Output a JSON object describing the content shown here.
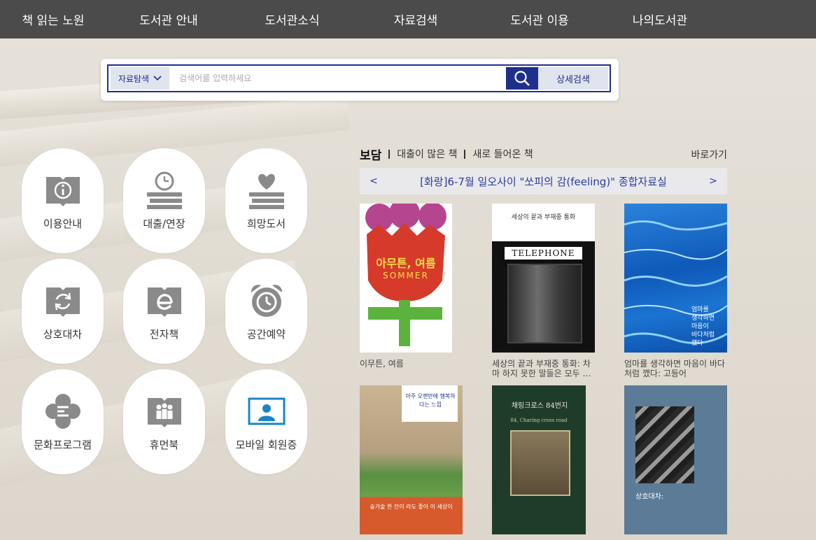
{
  "nav": [
    "책 읽는 노원",
    "도서관 안내",
    "도서관소식",
    "자료검색",
    "도서관 이용",
    "나의도서관"
  ],
  "search": {
    "select_label": "자료탐색",
    "placeholder": "검색어를 입력하세요",
    "detail_label": "상세검색"
  },
  "quick_menu": [
    {
      "label": "이용안내",
      "icon": "info-book-icon"
    },
    {
      "label": "대출/연장",
      "icon": "clock-books-icon"
    },
    {
      "label": "희망도서",
      "icon": "heart-books-icon"
    },
    {
      "label": "상호대차",
      "icon": "exchange-book-icon"
    },
    {
      "label": "전자책",
      "icon": "ebook-icon"
    },
    {
      "label": "공간예약",
      "icon": "alarm-clock-icon"
    },
    {
      "label": "문화프로그램",
      "icon": "flower-icon"
    },
    {
      "label": "휴먼북",
      "icon": "people-book-icon"
    },
    {
      "label": "모바일 회원증",
      "icon": "member-card-icon"
    }
  ],
  "books": {
    "tabs": [
      "보담",
      "대출이 많은 책",
      "새로 들어온 책"
    ],
    "goto_label": "바로가기",
    "banner": {
      "prev": "<",
      "title": "[화랑]6-7월 일오사이 \"쏘피의 감(feeling)\" 종합자료실",
      "next": ">"
    },
    "items": [
      {
        "title": "이무튼, 여름",
        "cover_color": "#ffffff"
      },
      {
        "title": "세상의 끝과 부재중 통화: 차마 하지 못한 말들은 모두 …",
        "cover_color": "#161616"
      },
      {
        "title": "엄마를 생각하면 마음이 바다 처럼 깼다: 고등어",
        "cover_color": "#1f6fd0"
      },
      {
        "title": "",
        "cover_color": "#d9c3a2"
      },
      {
        "title": "",
        "cover_color": "#1e3b2c"
      },
      {
        "title": "",
        "cover_color": "#5d7d98"
      }
    ],
    "cover_texts": {
      "b1_main": "아무튼, 여름",
      "b1_sub": "SOMMER",
      "b2_top": "세상의 끝과 부재중 통화",
      "b2_banner": "TELEPHONE",
      "b3_text": "엄마를 생각하면 마음이 바다처럼 깼다",
      "b4_banner": "아주 오랜만에 행복하다는 느낌",
      "b4_bottom": "숲가술 한 잔이 라도 좋아 이 세상이",
      "b5_title": "채링크로스 84번지",
      "b5_sub": "84, Charing cross road",
      "b6_title": "상호대차:"
    }
  }
}
